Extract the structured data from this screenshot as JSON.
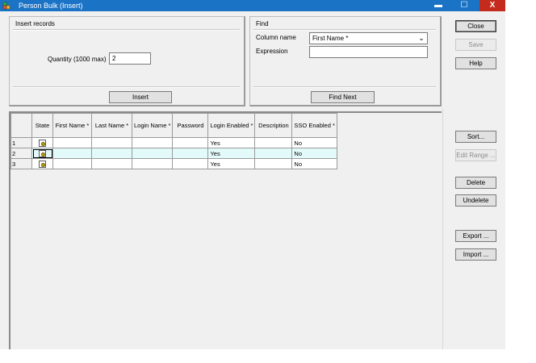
{
  "window": {
    "title": "Person Bulk (Insert)",
    "minimize_glyph": "▬",
    "maximize_glyph": "☐",
    "close_glyph": "X",
    "icon": "app-icon",
    "title_bar_color": "#1b73c6"
  },
  "insert_panel": {
    "title": "Insert records",
    "quantity_label": "Quantity (1000 max)",
    "quantity_value": "2",
    "insert_button": "Insert"
  },
  "find_panel": {
    "title": "Find",
    "column_name_label": "Column name",
    "column_name_value": "First Name *",
    "expression_label": "Expression",
    "expression_value": "",
    "find_next_button": "Find Next"
  },
  "side_buttons": {
    "close": "Close",
    "save": "Save",
    "help": "Help",
    "sort": "Sort...",
    "edit_range": "Edit Range ...",
    "delete": "Delete",
    "undelete": "Undelete",
    "export": "Export ...",
    "import": "Import ..."
  },
  "grid": {
    "columns": [
      "",
      "State",
      "First Name *",
      "Last Name *",
      "Login Name *",
      "Password",
      "Login Enabled *",
      "Description",
      "SSO Enabled *"
    ],
    "rows": [
      {
        "num": "1",
        "first_name": "",
        "last_name": "",
        "login_name": "",
        "password": "",
        "login_enabled": "Yes",
        "description": "",
        "sso_enabled": "No"
      },
      {
        "num": "2",
        "first_name": "",
        "last_name": "",
        "login_name": "",
        "password": "",
        "login_enabled": "Yes",
        "description": "",
        "sso_enabled": "No"
      },
      {
        "num": "3",
        "first_name": "",
        "last_name": "",
        "login_name": "",
        "password": "",
        "login_enabled": "Yes",
        "description": "",
        "sso_enabled": "No"
      }
    ],
    "selected_row_color": "#e3fafa"
  }
}
